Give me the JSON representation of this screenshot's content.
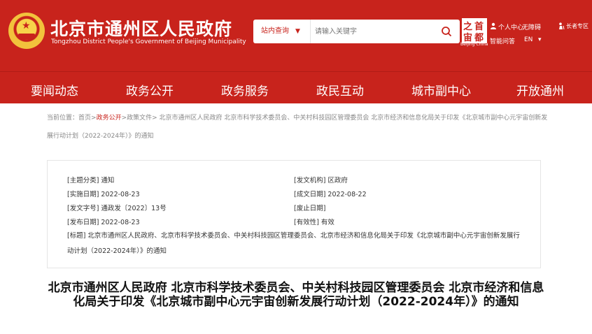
{
  "header": {
    "title": "北京市通州区人民政府",
    "subtitle": "Tongzhou District People's Government of Beijing Municipality",
    "search": {
      "scope": "站内查询",
      "placeholder": "请输入关键字"
    },
    "logo": {
      "chars": [
        "之",
        "首",
        "宙",
        "都"
      ],
      "caption": "Beijing·China"
    },
    "utilities": {
      "personal_center": "个人中心",
      "smart_qa": "智能问答",
      "accessibility": "无障碍",
      "language": "EN",
      "elder_zone": "长者专区"
    },
    "colors": {
      "brand": "#c8231c"
    }
  },
  "nav": {
    "items": [
      "要闻动态",
      "政务公开",
      "政务服务",
      "政民互动",
      "城市副中心",
      "开放通州"
    ]
  },
  "breadcrumb": {
    "label": "当前位置：",
    "home": "首页",
    "sep1": ">",
    "current": "政务公开",
    "sep2": ">",
    "rest": "政策文件> 北京市通州区人民政府 北京市科学技术委员会、中关村科技园区管理委员会 北京市经济和信息化局关于印发《北京城市副中心元宇宙创新发展行动计划（2022-2024年）》的通知"
  },
  "meta": {
    "topic": "[主题分类] 通知",
    "issuer": "[发文机构] 区政府",
    "effective_date": "[实施日期] 2022-08-23",
    "created_date": "[成文日期] 2022-08-22",
    "doc_number": "[发文字号] 通政发〔2022〕13号",
    "repeal_date": "[废止日期]",
    "publish_date": "[发布日期] 2022-08-23",
    "validity": "[有效性] 有效",
    "heading": "[标题] 北京市通州区人民政府、北京市科学技术委员会、中关村科技园区管理委员会、北京市经济和信息化局关于印发《北京城市副中心元宇宙创新发展行动计划（2022-2024年）》的通知"
  },
  "document": {
    "title": "北京市通州区人民政府 北京市科学技术委员会、中关村科技园区管理委员会 北京市经济和信息化局关于印发《北京城市副中心元宇宙创新发展行动计划（2022-2024年）》的通知"
  }
}
